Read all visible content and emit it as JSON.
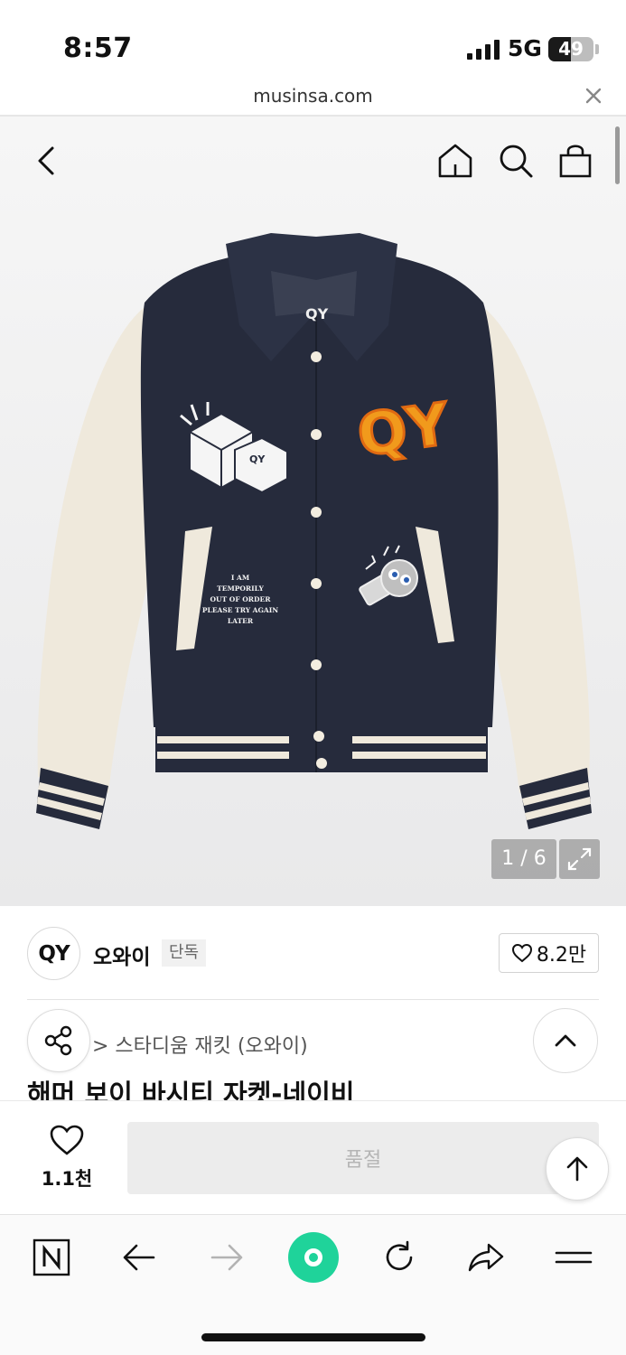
{
  "status_bar": {
    "time": "8:57",
    "network": "5G",
    "battery_level": 49,
    "battery_text": "49"
  },
  "browser": {
    "url": "musinsa.com"
  },
  "hero": {
    "image_counter": "1 / 6",
    "jacket_print": {
      "collar_label": "QY",
      "chest_logo": "QY",
      "cube_label": "QY",
      "pocket_text_1": "I AM",
      "pocket_text_2": "TEMPORILY",
      "pocket_text_3": "OUT OF ORDER",
      "pocket_text_4": "PLEASE TRY AGAIN",
      "pocket_text_5": "LATER"
    }
  },
  "brand": {
    "logo_text": "QY",
    "name": "오와이",
    "badge": "단독",
    "likes": "8.2만"
  },
  "product": {
    "category": "> 스타디움 재킷 (오와이)",
    "title": "해머 보이 바시티 자켓-네이비"
  },
  "purchase": {
    "wish_count": "1.1천",
    "button_label": "품절"
  },
  "colors": {
    "navy": "#262b3c",
    "cream": "#efe9dc",
    "orange": "#f19a1c",
    "toolbar_green": "#1fd39a"
  }
}
